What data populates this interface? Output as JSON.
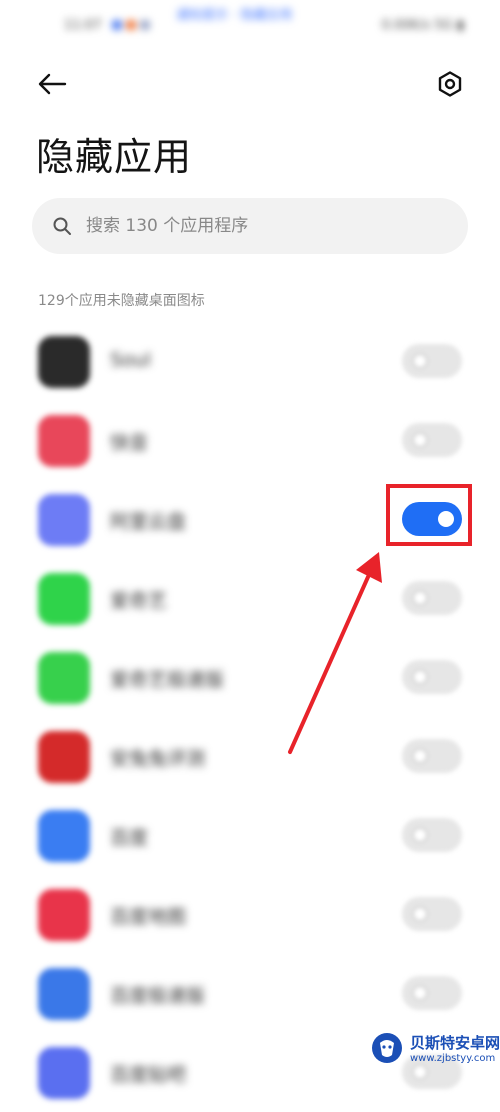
{
  "status_bar": {
    "time": "11:07",
    "center_text": "通知提示 · 隐藏应用",
    "right_text": "0.00K/s 5G ▮",
    "dot_colors": [
      "#4f7df0",
      "#f07a3f",
      "#9aa6c8"
    ]
  },
  "header": {
    "back_icon": "arrow-left-icon",
    "settings_icon": "gear-icon",
    "title": "隐藏应用"
  },
  "search": {
    "placeholder": "搜索 130 个应用程序"
  },
  "section": {
    "label": "129个应用未隐藏桌面图标"
  },
  "apps": [
    {
      "name": "Soul",
      "icon_color": "#2a2a2a",
      "hidden": false
    },
    {
      "name": "快音",
      "icon_color": "#e8475a",
      "hidden": false
    },
    {
      "name": "阿里云盘",
      "icon_color": "#6d7cf5",
      "hidden": true
    },
    {
      "name": "爱奇艺",
      "icon_color": "#2fd34a",
      "hidden": false
    },
    {
      "name": "爱奇艺极速版",
      "icon_color": "#37d04c",
      "hidden": false
    },
    {
      "name": "安兔兔评测",
      "icon_color": "#d42a2a",
      "hidden": false
    },
    {
      "name": "百度",
      "icon_color": "#3a7df2",
      "hidden": false
    },
    {
      "name": "百度地图",
      "icon_color": "#e8344a",
      "hidden": false
    },
    {
      "name": "百度极速版",
      "icon_color": "#3a78e8",
      "hidden": false
    },
    {
      "name": "百度贴吧",
      "icon_color": "#5a6ff0",
      "hidden": false
    }
  ],
  "watermark": {
    "title": "贝斯特安卓网",
    "url": "www.zjbstyy.com"
  },
  "colors": {
    "accent": "#1f6ef5",
    "annotation": "#e8232a"
  }
}
